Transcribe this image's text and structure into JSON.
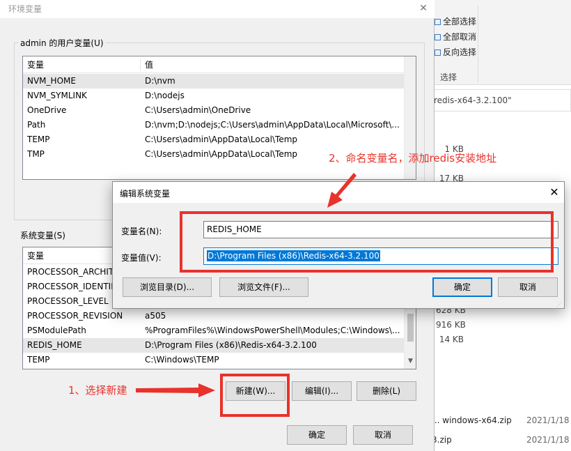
{
  "background_explorer": {
    "ribbon_items": [
      "全部选择",
      "全部取消",
      "反向选择"
    ],
    "ribbon_group_caption": "选择",
    "path_fragment": "redis-x64-3.2.100\"",
    "sizes": [
      "1 KB",
      "17 KB",
      "628 KB",
      "916 KB",
      "14 KB"
    ],
    "file_a": "... windows-x64.zip",
    "file_b": "3.zip",
    "date_a": "2021/1/18",
    "date_b": "2021/1/18"
  },
  "env_dialog": {
    "title": "环境变量",
    "close_glyph": "✕",
    "user_group_label": "admin 的用户变量(U)",
    "system_group_label": "系统变量(S)",
    "columns": {
      "name": "变量",
      "value": "值"
    },
    "user_vars": [
      {
        "name": "NVM_HOME",
        "value": "D:\\nvm"
      },
      {
        "name": "NVM_SYMLINK",
        "value": "D:\\nodejs"
      },
      {
        "name": "OneDrive",
        "value": "C:\\Users\\admin\\OneDrive"
      },
      {
        "name": "Path",
        "value": "D:\\nvm;D:\\nodejs;C:\\Users\\admin\\AppData\\Local\\Microsoft\\..."
      },
      {
        "name": "TEMP",
        "value": "C:\\Users\\admin\\AppData\\Local\\Temp"
      },
      {
        "name": "TMP",
        "value": "C:\\Users\\admin\\AppData\\Local\\Temp"
      }
    ],
    "system_vars": [
      {
        "name": "PROCESSOR_ARCHITECTURE",
        "value": ""
      },
      {
        "name": "PROCESSOR_IDENTIFIER",
        "value": ""
      },
      {
        "name": "PROCESSOR_LEVEL",
        "value": ""
      },
      {
        "name": "PROCESSOR_REVISION",
        "value": "a505"
      },
      {
        "name": "PSModulePath",
        "value": "%ProgramFiles%\\WindowsPowerShell\\Modules;C:\\Windows\\..."
      },
      {
        "name": "REDIS_HOME",
        "value": "D:\\Program Files (x86)\\Redis-x64-3.2.100"
      },
      {
        "name": "TEMP",
        "value": "C:\\Windows\\TEMP"
      }
    ],
    "buttons": {
      "new": "新建(W)...",
      "edit": "编辑(I)...",
      "delete": "删除(L)",
      "ok": "确定",
      "cancel": "取消"
    }
  },
  "edit_dialog": {
    "title": "编辑系统变量",
    "close_glyph": "✕",
    "name_label": "变量名(N):",
    "value_label": "变量值(V):",
    "name_value": "REDIS_HOME",
    "value_value": "D:\\Program Files (x86)\\Redis-x64-3.2.100",
    "buttons": {
      "browse_dir": "浏览目录(D)...",
      "browse_file": "浏览文件(F)...",
      "ok": "确定",
      "cancel": "取消"
    }
  },
  "annotations": {
    "step1": "1、选择新建",
    "step2": "2、命名变量名，添加redis安装地址",
    "color": "#e8322b"
  }
}
